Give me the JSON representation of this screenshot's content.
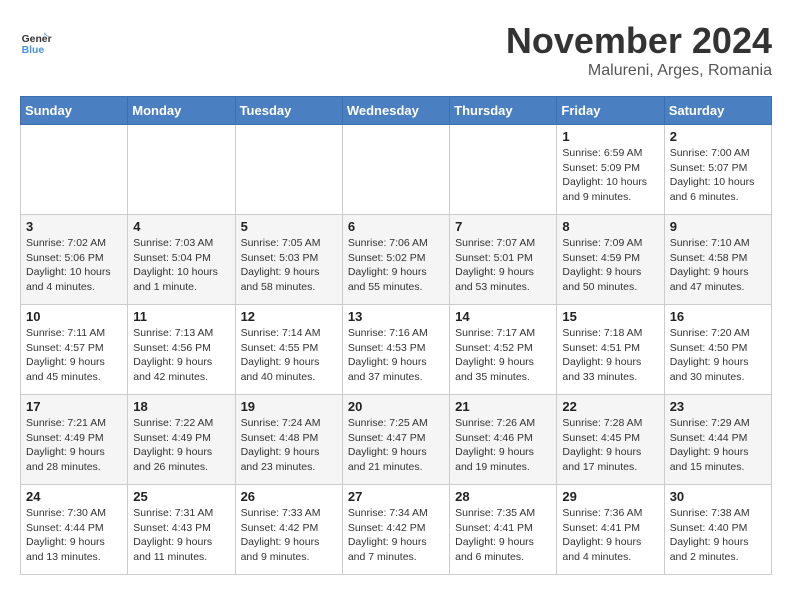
{
  "logo": {
    "line1": "General",
    "line2": "Blue"
  },
  "title": "November 2024",
  "subtitle": "Malureni, Arges, Romania",
  "weekdays": [
    "Sunday",
    "Monday",
    "Tuesday",
    "Wednesday",
    "Thursday",
    "Friday",
    "Saturday"
  ],
  "weeks": [
    [
      {
        "day": "",
        "info": ""
      },
      {
        "day": "",
        "info": ""
      },
      {
        "day": "",
        "info": ""
      },
      {
        "day": "",
        "info": ""
      },
      {
        "day": "",
        "info": ""
      },
      {
        "day": "1",
        "info": "Sunrise: 6:59 AM\nSunset: 5:09 PM\nDaylight: 10 hours and 9 minutes."
      },
      {
        "day": "2",
        "info": "Sunrise: 7:00 AM\nSunset: 5:07 PM\nDaylight: 10 hours and 6 minutes."
      }
    ],
    [
      {
        "day": "3",
        "info": "Sunrise: 7:02 AM\nSunset: 5:06 PM\nDaylight: 10 hours and 4 minutes."
      },
      {
        "day": "4",
        "info": "Sunrise: 7:03 AM\nSunset: 5:04 PM\nDaylight: 10 hours and 1 minute."
      },
      {
        "day": "5",
        "info": "Sunrise: 7:05 AM\nSunset: 5:03 PM\nDaylight: 9 hours and 58 minutes."
      },
      {
        "day": "6",
        "info": "Sunrise: 7:06 AM\nSunset: 5:02 PM\nDaylight: 9 hours and 55 minutes."
      },
      {
        "day": "7",
        "info": "Sunrise: 7:07 AM\nSunset: 5:01 PM\nDaylight: 9 hours and 53 minutes."
      },
      {
        "day": "8",
        "info": "Sunrise: 7:09 AM\nSunset: 4:59 PM\nDaylight: 9 hours and 50 minutes."
      },
      {
        "day": "9",
        "info": "Sunrise: 7:10 AM\nSunset: 4:58 PM\nDaylight: 9 hours and 47 minutes."
      }
    ],
    [
      {
        "day": "10",
        "info": "Sunrise: 7:11 AM\nSunset: 4:57 PM\nDaylight: 9 hours and 45 minutes."
      },
      {
        "day": "11",
        "info": "Sunrise: 7:13 AM\nSunset: 4:56 PM\nDaylight: 9 hours and 42 minutes."
      },
      {
        "day": "12",
        "info": "Sunrise: 7:14 AM\nSunset: 4:55 PM\nDaylight: 9 hours and 40 minutes."
      },
      {
        "day": "13",
        "info": "Sunrise: 7:16 AM\nSunset: 4:53 PM\nDaylight: 9 hours and 37 minutes."
      },
      {
        "day": "14",
        "info": "Sunrise: 7:17 AM\nSunset: 4:52 PM\nDaylight: 9 hours and 35 minutes."
      },
      {
        "day": "15",
        "info": "Sunrise: 7:18 AM\nSunset: 4:51 PM\nDaylight: 9 hours and 33 minutes."
      },
      {
        "day": "16",
        "info": "Sunrise: 7:20 AM\nSunset: 4:50 PM\nDaylight: 9 hours and 30 minutes."
      }
    ],
    [
      {
        "day": "17",
        "info": "Sunrise: 7:21 AM\nSunset: 4:49 PM\nDaylight: 9 hours and 28 minutes."
      },
      {
        "day": "18",
        "info": "Sunrise: 7:22 AM\nSunset: 4:49 PM\nDaylight: 9 hours and 26 minutes."
      },
      {
        "day": "19",
        "info": "Sunrise: 7:24 AM\nSunset: 4:48 PM\nDaylight: 9 hours and 23 minutes."
      },
      {
        "day": "20",
        "info": "Sunrise: 7:25 AM\nSunset: 4:47 PM\nDaylight: 9 hours and 21 minutes."
      },
      {
        "day": "21",
        "info": "Sunrise: 7:26 AM\nSunset: 4:46 PM\nDaylight: 9 hours and 19 minutes."
      },
      {
        "day": "22",
        "info": "Sunrise: 7:28 AM\nSunset: 4:45 PM\nDaylight: 9 hours and 17 minutes."
      },
      {
        "day": "23",
        "info": "Sunrise: 7:29 AM\nSunset: 4:44 PM\nDaylight: 9 hours and 15 minutes."
      }
    ],
    [
      {
        "day": "24",
        "info": "Sunrise: 7:30 AM\nSunset: 4:44 PM\nDaylight: 9 hours and 13 minutes."
      },
      {
        "day": "25",
        "info": "Sunrise: 7:31 AM\nSunset: 4:43 PM\nDaylight: 9 hours and 11 minutes."
      },
      {
        "day": "26",
        "info": "Sunrise: 7:33 AM\nSunset: 4:42 PM\nDaylight: 9 hours and 9 minutes."
      },
      {
        "day": "27",
        "info": "Sunrise: 7:34 AM\nSunset: 4:42 PM\nDaylight: 9 hours and 7 minutes."
      },
      {
        "day": "28",
        "info": "Sunrise: 7:35 AM\nSunset: 4:41 PM\nDaylight: 9 hours and 6 minutes."
      },
      {
        "day": "29",
        "info": "Sunrise: 7:36 AM\nSunset: 4:41 PM\nDaylight: 9 hours and 4 minutes."
      },
      {
        "day": "30",
        "info": "Sunrise: 7:38 AM\nSunset: 4:40 PM\nDaylight: 9 hours and 2 minutes."
      }
    ]
  ]
}
